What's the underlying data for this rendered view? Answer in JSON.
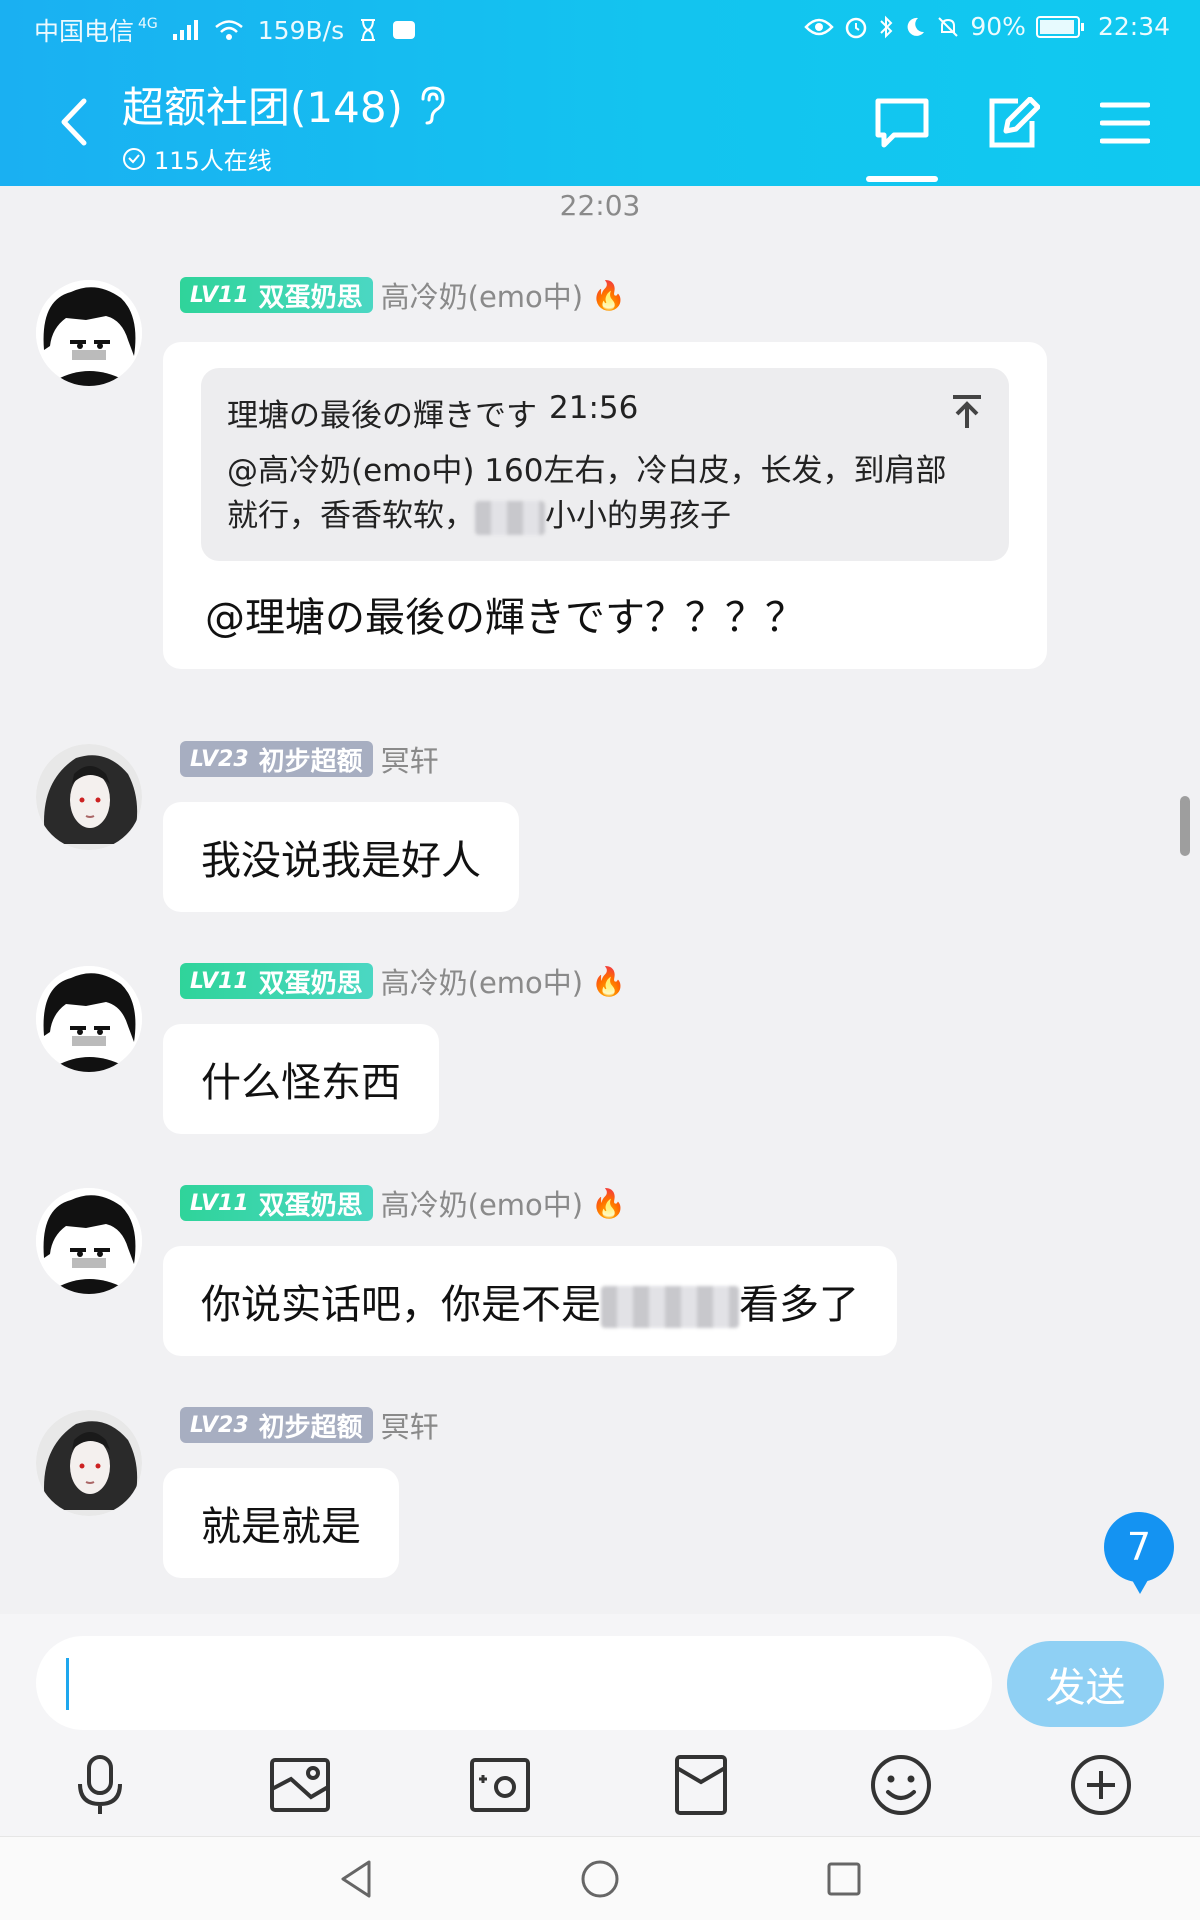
{
  "status_bar": {
    "carrier": "中国电信",
    "network": "4G",
    "speed": "159B/s",
    "battery": "90%",
    "time": "22:34"
  },
  "header": {
    "title": "超额社团(148)",
    "online": "115人在线",
    "back_icon": "chevron-left-icon",
    "actions": [
      "chat-icon",
      "edit-icon",
      "menu-icon"
    ]
  },
  "chat": {
    "timestamp": "22:03",
    "messages": [
      {
        "badge_level": "LV11",
        "badge_title": "双蛋奶思",
        "badge_color": "#33d4a6",
        "nickname": "高冷奶(emo中)",
        "fire": "🔥",
        "quote": {
          "author": "理塘の最後の輝きです",
          "time": "21:56",
          "text_a": "@高冷奶(emo中) 160左右，冷白皮，长发，到肩部就行，香香软软，",
          "text_b": "小小的男孩子"
        },
        "text": "@理塘の最後の輝きです？？？？"
      },
      {
        "badge_level": "LV23",
        "badge_title": "初步超额",
        "badge_color": "#a7aec1",
        "nickname": "冥轩",
        "text": "我没说我是好人"
      },
      {
        "badge_level": "LV11",
        "badge_title": "双蛋奶思",
        "badge_color": "#33d4a6",
        "nickname": "高冷奶(emo中)",
        "fire": "🔥",
        "text": "什么怪东西"
      },
      {
        "badge_level": "LV11",
        "badge_title": "双蛋奶思",
        "badge_color": "#33d4a6",
        "nickname": "高冷奶(emo中)",
        "fire": "🔥",
        "text_a": "你说实话吧，你是不是",
        "text_b": "看多了"
      },
      {
        "badge_level": "LV23",
        "badge_title": "初步超额",
        "badge_color": "#a7aec1",
        "nickname": "冥轩",
        "text": "就是就是"
      }
    ],
    "unread_count": "7"
  },
  "input": {
    "value": "",
    "send_label": "发送"
  },
  "toolbar": [
    "mic-icon",
    "image-icon",
    "camera-icon",
    "red-packet-icon",
    "emoji-icon",
    "plus-icon"
  ],
  "nav": [
    "back-triangle-icon",
    "home-circle-icon",
    "recents-square-icon"
  ]
}
